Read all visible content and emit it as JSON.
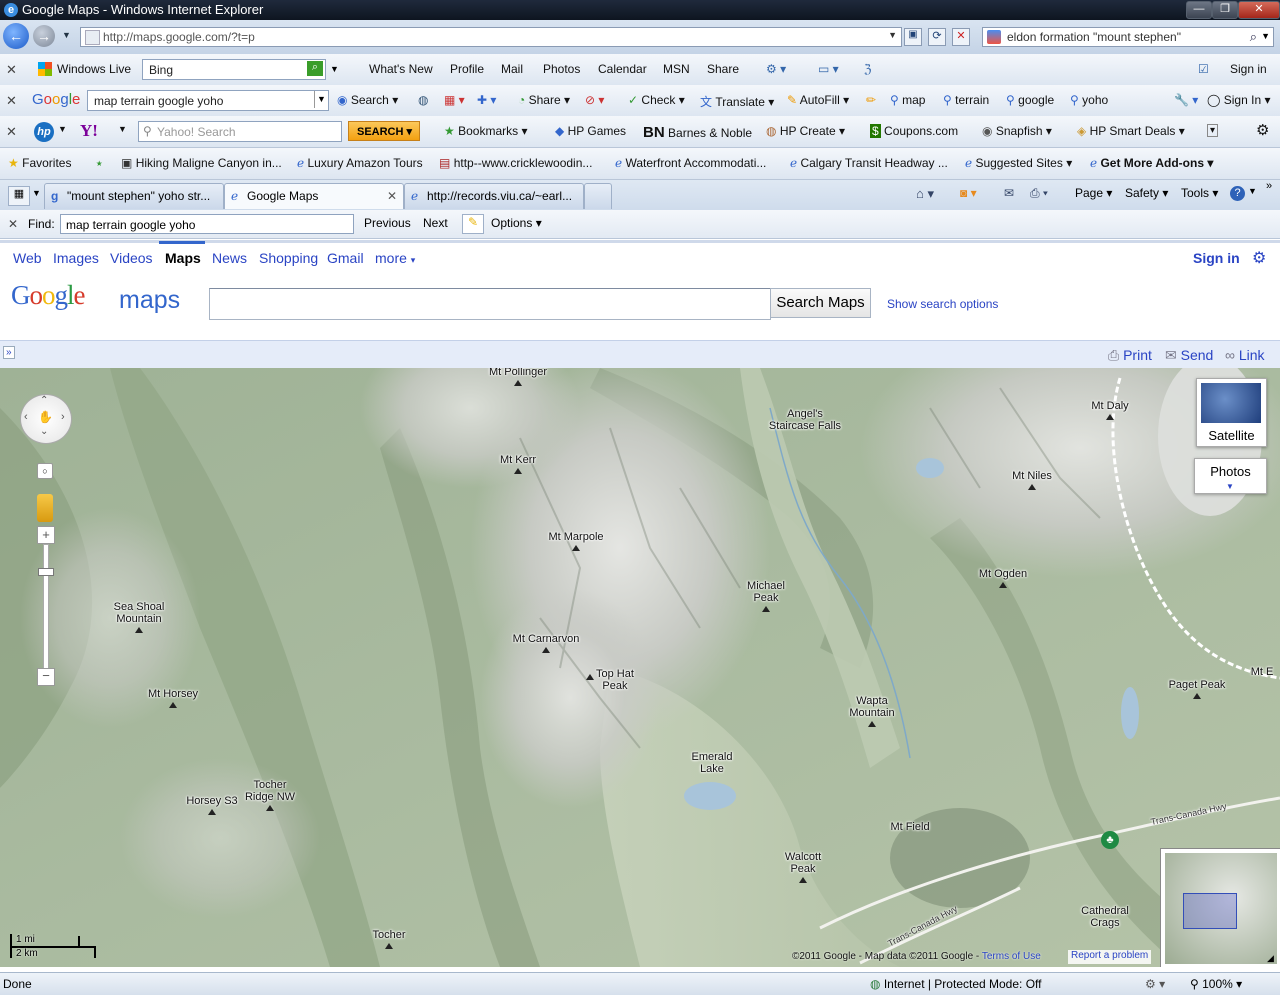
{
  "window": {
    "title": "Google Maps - Windows Internet Explorer"
  },
  "address": {
    "url": "http://maps.google.com/?t=p",
    "search_query": "eldon formation \"mount stephen\""
  },
  "toolbar_live": {
    "brand": "Windows Live",
    "search_value": "Bing",
    "links": [
      "What's New",
      "Profile",
      "Mail",
      "Photos",
      "Calendar",
      "MSN",
      "Share"
    ],
    "sign_in": "Sign in"
  },
  "toolbar_google": {
    "brand": "Google",
    "query": "map terrain google yoho",
    "search": "Search",
    "share": "Share",
    "check": "Check",
    "translate": "Translate",
    "autofill": "AutoFill",
    "terms": [
      "map",
      "terrain",
      "google",
      "yoho"
    ],
    "sign_in": "Sign In"
  },
  "toolbar_yahoo": {
    "placeholder": "Yahoo! Search",
    "search_btn": "SEARCH",
    "items": [
      "Bookmarks",
      "HP Games",
      "Barnes & Noble",
      "HP Create",
      "Coupons.com",
      "Snapfish",
      "HP Smart Deals"
    ]
  },
  "favorites": {
    "label": "Favorites",
    "items": [
      "Hiking Maligne Canyon in...",
      "Luxury Amazon Tours",
      "http--www.cricklewoodin...",
      "Waterfront Accommodati...",
      "Calgary Transit Headway ...",
      "Suggested Sites",
      "Get More Add-ons"
    ]
  },
  "tabs": [
    "\"mount stephen\" yoho str...",
    "Google Maps",
    "http://records.viu.ca/~earl..."
  ],
  "command_bar": {
    "page": "Page",
    "safety": "Safety",
    "tools": "Tools"
  },
  "find": {
    "label": "Find:",
    "value": "map terrain google yoho",
    "previous": "Previous",
    "next": "Next",
    "options": "Options"
  },
  "gbar": {
    "links": [
      "Web",
      "Images",
      "Videos",
      "Maps",
      "News",
      "Shopping",
      "Gmail",
      "more"
    ],
    "sign_in": "Sign in"
  },
  "maps_header": {
    "logo_google": "Google",
    "logo_maps": "maps",
    "search_button": "Search Maps",
    "show_options": "Show search options"
  },
  "panel_bar": {
    "print": "Print",
    "send": "Send",
    "link": "Link"
  },
  "map": {
    "satellite": "Satellite",
    "photos": "Photos",
    "scale": {
      "mi": "1 mi",
      "km": "2 km"
    },
    "copyright": "©2011 Google - Map data ©2011 Google -",
    "terms": "Terms of Use",
    "report": "Report a problem",
    "labels": [
      {
        "name": "Mt Pollinger",
        "lines": [
          "Mt Pollinger"
        ]
      },
      {
        "name": "Angel's Staircase Falls",
        "lines": [
          "Angel's",
          "Staircase Falls"
        ]
      },
      {
        "name": "Mt Daly",
        "lines": [
          "Mt Daly"
        ]
      },
      {
        "name": "Mt Kerr",
        "lines": [
          "Mt Kerr"
        ]
      },
      {
        "name": "Mt Niles",
        "lines": [
          "Mt Niles"
        ]
      },
      {
        "name": "Mt Marpole",
        "lines": [
          "Mt Marpole"
        ]
      },
      {
        "name": "Mt Ogden",
        "lines": [
          "Mt Ogden"
        ]
      },
      {
        "name": "Michael Peak",
        "lines": [
          "Michael",
          "Peak"
        ]
      },
      {
        "name": "Sea Shoal Mountain",
        "lines": [
          "Sea Shoal",
          "Mountain"
        ]
      },
      {
        "name": "Mt Carnarvon",
        "lines": [
          "Mt Carnarvon"
        ]
      },
      {
        "name": "Top Hat Peak",
        "lines": [
          "Top Hat",
          "Peak"
        ]
      },
      {
        "name": "Paget Peak",
        "lines": [
          "Paget Peak"
        ]
      },
      {
        "name": "Mt Horsey",
        "lines": [
          "Mt Horsey"
        ]
      },
      {
        "name": "Wapta Mountain",
        "lines": [
          "Wapta",
          "Mountain"
        ]
      },
      {
        "name": "Emerald Lake",
        "lines": [
          "Emerald",
          "Lake"
        ]
      },
      {
        "name": "Horsey S3",
        "lines": [
          "Horsey S3"
        ]
      },
      {
        "name": "Tocher Ridge NW",
        "lines": [
          "Tocher",
          "Ridge NW"
        ]
      },
      {
        "name": "Mt Field",
        "lines": [
          "Mt Field"
        ]
      },
      {
        "name": "Walcott Peak",
        "lines": [
          "Walcott",
          "Peak"
        ]
      },
      {
        "name": "Cathedral Crags",
        "lines": [
          "Cathedral",
          "Crags"
        ]
      },
      {
        "name": "Tocher",
        "lines": [
          "Tocher"
        ]
      },
      {
        "name": "Mt E",
        "lines": [
          "Mt E"
        ]
      }
    ],
    "roads": [
      "Trans-Canada Hwy",
      "Trans-Canada Hwy"
    ]
  },
  "status": {
    "left": "Done",
    "zone": "Internet | Protected Mode: Off",
    "zoom": "100%"
  }
}
